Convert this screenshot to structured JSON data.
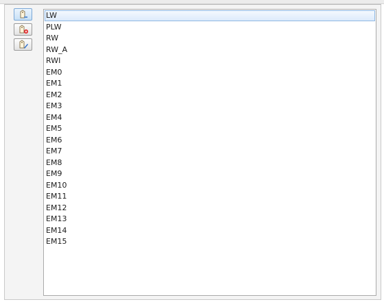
{
  "toolbar": {
    "buttons": [
      {
        "icon": "tag-icon",
        "active": true
      },
      {
        "icon": "tag-add-icon",
        "active": false
      },
      {
        "icon": "tag-edit-icon",
        "active": false
      }
    ]
  },
  "list": {
    "selected_index": 0,
    "items": [
      "LW",
      "PLW",
      "RW",
      "RW_A",
      "RWI",
      "EM0",
      "EM1",
      "EM2",
      "EM3",
      "EM4",
      "EM5",
      "EM6",
      "EM7",
      "EM8",
      "EM9",
      "EM10",
      "EM11",
      "EM12",
      "EM13",
      "EM14",
      "EM15"
    ]
  },
  "colors": {
    "selection_border": "#8fb8e3",
    "selection_fill": "#dcebfb",
    "add_badge": "#e02020",
    "edit_pencil": "#2a6fc9"
  }
}
